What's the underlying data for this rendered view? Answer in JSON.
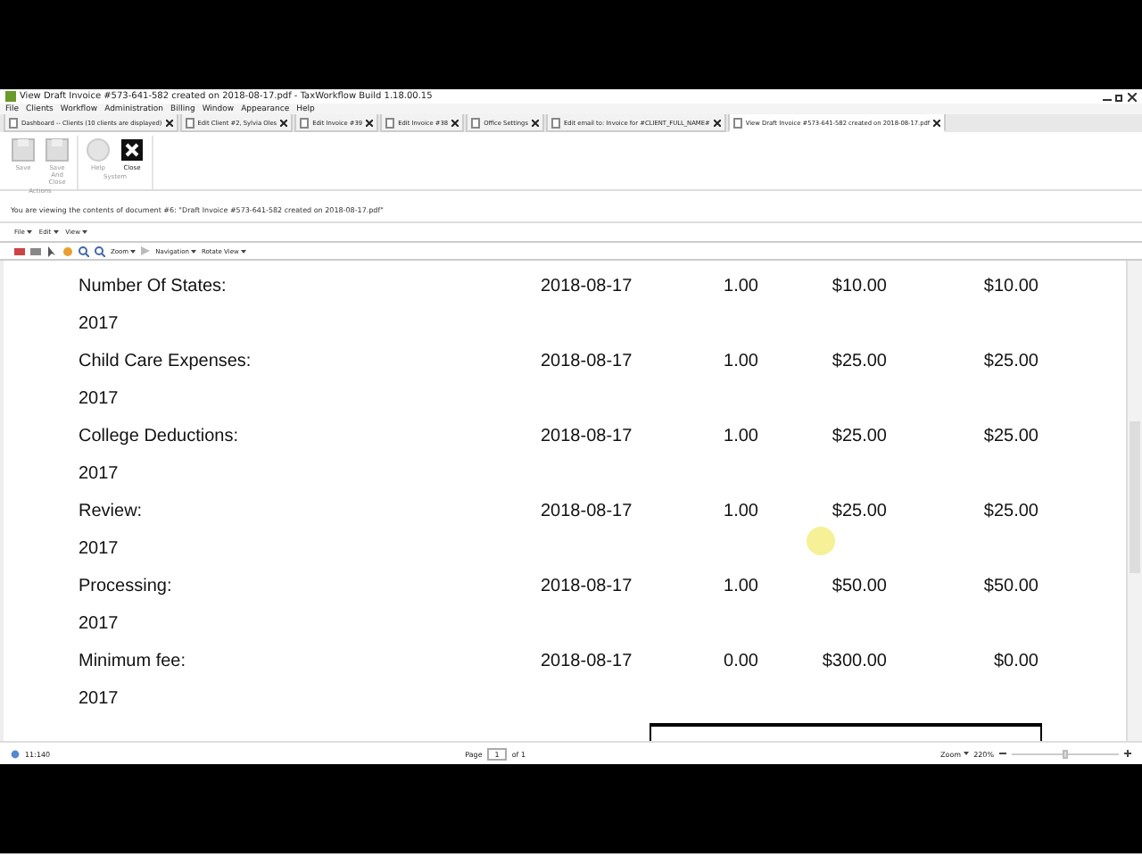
{
  "window": {
    "title": "View Draft Invoice #573-641-582 created on 2018-08-17.pdf - TaxWorkflow Build 1.18.00.15"
  },
  "menu": [
    "File",
    "Clients",
    "Workflow",
    "Administration",
    "Billing",
    "Window",
    "Appearance",
    "Help"
  ],
  "tabs": [
    {
      "label": "Dashboard -- Clients (10 clients are displayed)",
      "selected": false
    },
    {
      "label": "Edit Client #2, Sylvia Oles",
      "selected": false
    },
    {
      "label": "Edit Invoice #39",
      "selected": false
    },
    {
      "label": "Edit Invoice #38",
      "selected": false
    },
    {
      "label": "Office Settings",
      "selected": false
    },
    {
      "label": "Edit email to: Invoice for #CLIENT_FULL_NAME#",
      "selected": false
    },
    {
      "label": "View Draft Invoice #573-641-582 created on 2018-08-17.pdf",
      "selected": true
    }
  ],
  "ribbon": [
    {
      "group": "Actions",
      "buttons": [
        {
          "label": "Save",
          "kind": "save",
          "disabled": true
        },
        {
          "label": "Save And Close",
          "kind": "saveclose",
          "disabled": true
        }
      ]
    },
    {
      "group": "System",
      "buttons": [
        {
          "label": "Help",
          "kind": "help",
          "disabled": true
        },
        {
          "label": "Close",
          "kind": "close",
          "disabled": false
        }
      ]
    }
  ],
  "info": "You are viewing the contents of document #6: \"Draft Invoice #573-641-582 created on 2018-08-17.pdf\"",
  "viewer_menu": [
    "File",
    "Edit",
    "View"
  ],
  "viewer_toolbar": {
    "zoom": "Zoom",
    "navigation": "Navigation",
    "rotate": "Rotate View"
  },
  "rows": [
    {
      "name": "Number Of States:",
      "year": "2017",
      "date": "2018-08-17",
      "qty": "1.00",
      "price": "$10.00",
      "total": "$10.00"
    },
    {
      "name": "Child Care Expenses:",
      "year": "2017",
      "date": "2018-08-17",
      "qty": "1.00",
      "price": "$25.00",
      "total": "$25.00"
    },
    {
      "name": "College Deductions:",
      "year": "2017",
      "date": "2018-08-17",
      "qty": "1.00",
      "price": "$25.00",
      "total": "$25.00"
    },
    {
      "name": "Review:",
      "year": "2017",
      "date": "2018-08-17",
      "qty": "1.00",
      "price": "$25.00",
      "total": "$25.00"
    },
    {
      "name": "Processing:",
      "year": "2017",
      "date": "2018-08-17",
      "qty": "1.00",
      "price": "$50.00",
      "total": "$50.00"
    },
    {
      "name": "Minimum fee:",
      "year": "2017",
      "date": "2018-08-17",
      "qty": "0.00",
      "price": "$300.00",
      "total": "$0.00"
    }
  ],
  "status": {
    "left": "11:140",
    "page_label": "Page",
    "page": "1",
    "of": "of 1",
    "zoom": "Zoom",
    "zoom_value": "220%",
    "level": 0.5
  }
}
